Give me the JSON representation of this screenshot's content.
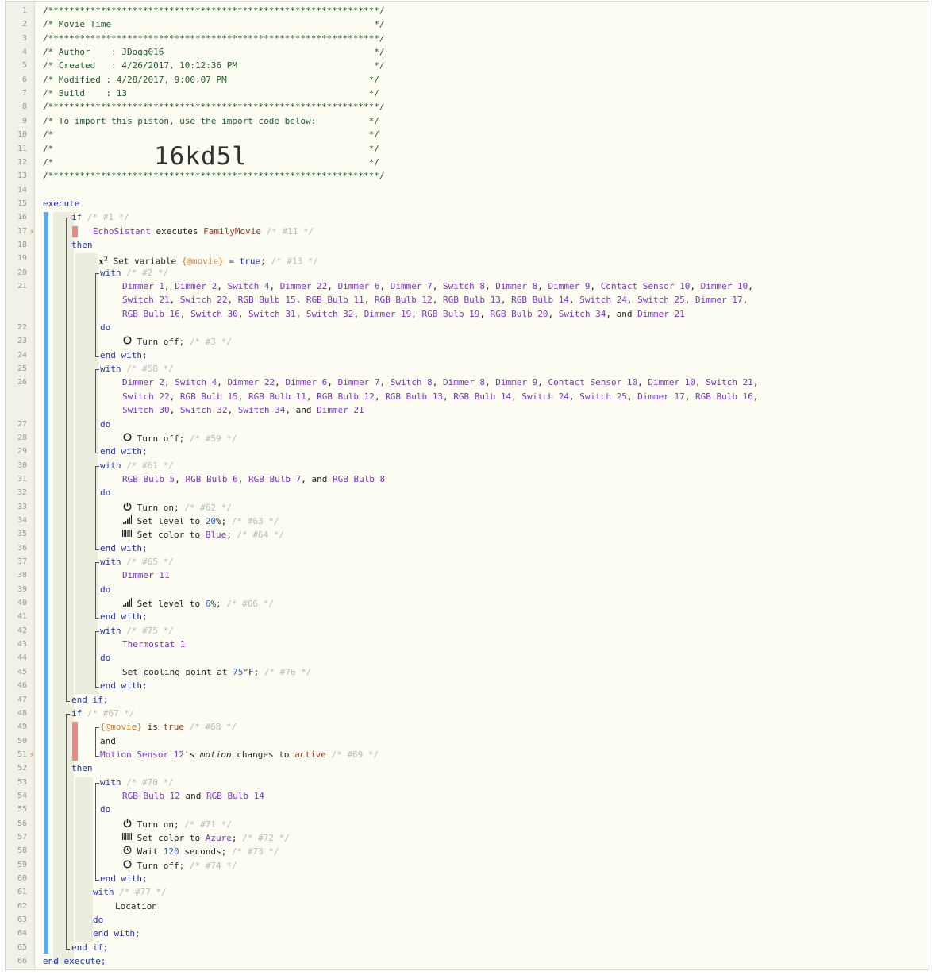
{
  "header": {
    "stars": "/***************************************************************/",
    "title_line": "/* Movie Time                                                  */",
    "author_line": "/* Author    : JDogg016                                        */",
    "created_line": "/* Created   : 4/26/2017, 10:12:36 PM                          */",
    "modified_line": "/* Modified : 4/28/2017, 9:00:07 PM                           */",
    "build_line": "/* Build    : 13                                              */",
    "import_line": "/* To import this piston, use the import code below:          */",
    "blank_line": "/*                                                            */",
    "import_code": "16kd5l"
  },
  "kw": {
    "execute": "execute",
    "end_execute": "end execute;",
    "if": "if",
    "then": "then",
    "end_if": "end if;",
    "with": "with",
    "do": "do",
    "end_with": "end with;",
    "and": "and",
    "oxford_and": ", and ",
    "comma": ", ",
    "semi": ";"
  },
  "statements": {
    "c1": "/* #1 */",
    "trig_dev": "EchoSistant",
    "trig_mid": " executes ",
    "trig_val": "FamilyMovie",
    "c11": "/* #11 */",
    "setvar_prefix": "Set variable ",
    "setvar_name": "{@movie}",
    "setvar_eq": " = ",
    "setvar_val": "true",
    "c13": "/* #13 */",
    "c2": "/* #2 */",
    "c3": "/* #3 */",
    "c58": "/* #58 */",
    "c59": "/* #59 */",
    "c61": "/* #61 */",
    "c62": "/* #62 */",
    "c63": "/* #63 */",
    "c64": "/* #64 */",
    "c65": "/* #65 */",
    "c66": "/* #66 */",
    "c75": "/* #75 */",
    "c76": "/* #76 */",
    "c67": "/* #67 */",
    "c68": "/* #68 */",
    "c69": "/* #69 */",
    "c70": "/* #70 */",
    "c71": "/* #71 */",
    "c72": "/* #72 */",
    "c73": "/* #73 */",
    "c74": "/* #74 */",
    "c77": "/* #77 */",
    "turn_off": "Turn off;",
    "turn_on": "Turn on;",
    "set_level_to": "Set level to ",
    "pct_semi": "%;",
    "level_20": "20",
    "level_6": "6",
    "set_color_to": "Set color to ",
    "color_blue": "Blue",
    "color_azure": "Azure",
    "set_cooling": "Set cooling point at ",
    "temp_75": "75",
    "deg_f_semi": "°F;",
    "dimmer_11": "Dimmer 11",
    "thermostat_1": "Thermostat 1",
    "cond_var": "{@movie}",
    "is": " is ",
    "true": "true",
    "motion_dev": "Motion Sensor 12",
    "motion_s": "'s ",
    "motion_attr": "motion",
    "changes_to": " changes to ",
    "active": "active",
    "rgb12": "RGB Bulb 12",
    "rgb14": "RGB Bulb 14",
    "wait": "Wait ",
    "wait_num": "120",
    "seconds": " seconds;",
    "location": "Location"
  },
  "devices_group1": [
    "Dimmer 1",
    "Dimmer 2",
    "Switch 4",
    "Dimmer 22",
    "Dimmer 6",
    "Dimmer 7",
    "Switch 8",
    "Dimmer 8",
    "Dimmer 9",
    "Contact Sensor 10",
    "Dimmer 10",
    "Switch 21",
    "Switch 22",
    "RGB Bulb 15",
    "RGB Bulb 11",
    "RGB Bulb 12",
    "RGB Bulb 13",
    "RGB Bulb 14",
    "Switch 24",
    "Switch 25",
    "Dimmer 17",
    "RGB Bulb 16",
    "Switch 30",
    "Switch 31",
    "Switch 32",
    "Dimmer 19",
    "RGB Bulb 19",
    "RGB Bulb 20",
    "Switch 34",
    "Dimmer 21"
  ],
  "devices_group2": [
    "Dimmer 2",
    "Switch 4",
    "Dimmer 22",
    "Dimmer 6",
    "Dimmer 7",
    "Switch 8",
    "Dimmer 8",
    "Dimmer 9",
    "Contact Sensor 10",
    "Dimmer 10",
    "Switch 21",
    "Switch 22",
    "RGB Bulb 15",
    "RGB Bulb 11",
    "RGB Bulb 12",
    "RGB Bulb 13",
    "RGB Bulb 14",
    "Switch 24",
    "Switch 25",
    "Dimmer 17",
    "RGB Bulb 16",
    "Switch 30",
    "Switch 32",
    "Switch 34",
    "Dimmer 21"
  ],
  "devices_group3": [
    "RGB Bulb 5",
    "RGB Bulb 6",
    "RGB Bulb 7",
    "RGB Bulb 8"
  ],
  "icons": {
    "power": "power-icon",
    "level": "signal-bars-icon",
    "color": "color-bars-icon",
    "timer": "timer-icon",
    "variable": "x-squared-icon",
    "trigger": "lightning-bolt-icon"
  }
}
